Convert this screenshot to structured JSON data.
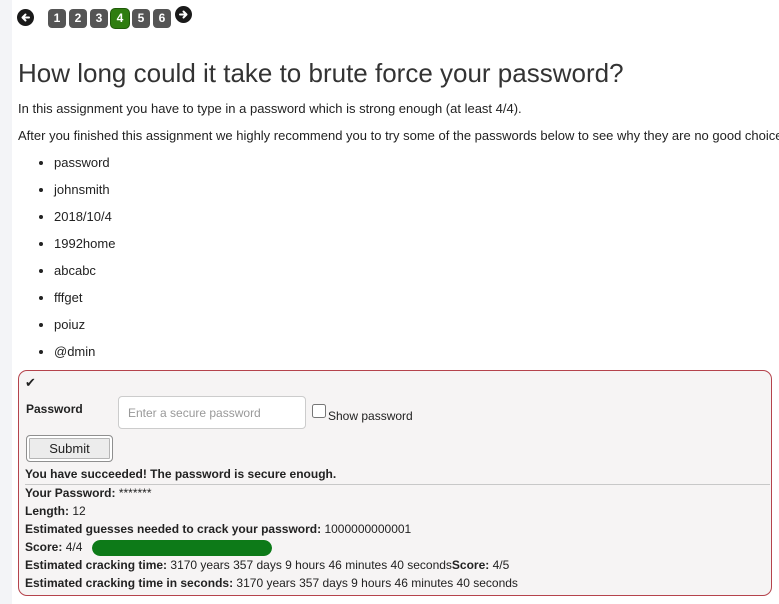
{
  "nav": {
    "prev_icon": "arrow-left-circle-icon",
    "next_icon": "arrow-right-circle-icon",
    "pages": [
      "1",
      "2",
      "3",
      "4",
      "5",
      "6"
    ],
    "active_page": "4"
  },
  "title": "How long could it take to brute force your password?",
  "intro": "In this assignment you have to type in a password which is strong enough (at least 4/4).",
  "recommendation": "After you finished this assignment we highly recommend you to try some of the passwords below to see why they are no good choices:",
  "passwords": [
    "password",
    "johnsmith",
    "2018/10/4",
    "1992home",
    "abcabc",
    "fffget",
    "poiuz",
    "@dmin"
  ],
  "form": {
    "check_icon": "checkmark-icon",
    "password_label": "Password",
    "password_placeholder": "Enter a secure password",
    "password_value": "",
    "show_password_label": "Show password",
    "show_password_checked": false,
    "submit_label": "Submit"
  },
  "result": {
    "success_message": "You have succeeded! The password is secure enough.",
    "your_password_label": "Your Password:",
    "your_password_value": "*******",
    "length_label": "Length:",
    "length_value": "12",
    "guesses_label": "Estimated guesses needed to crack your password:",
    "guesses_value": "1000000000001",
    "score_label": "Score:",
    "score_value": "4/4",
    "score_fraction": 1.0,
    "score_bar_color": "#0d7a18",
    "cracking_time_label": "Estimated cracking time:",
    "cracking_time_value": "3170 years 357 days 9 hours 46 minutes 40 seconds",
    "cracking_score_label": "Score:",
    "cracking_score_value": "4/5",
    "cracking_seconds_label": "Estimated cracking time in seconds:",
    "cracking_seconds_value": "3170 years 357 days 9 hours 46 minutes 40 seconds"
  },
  "colors": {
    "active_page": "#2f7d10",
    "page_button": "#555555",
    "box_border": "#b5434c",
    "box_background": "#f6f4f4"
  }
}
